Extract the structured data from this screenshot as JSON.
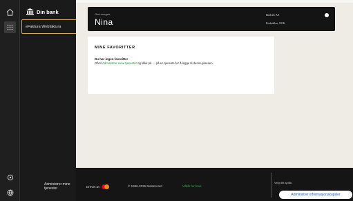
{
  "sidebar": {
    "bank_label": "Din bank",
    "nav_item": "eFaktura Webfaktura",
    "collapse_label": "‹",
    "footer_link": "Administrer mine tjenester"
  },
  "greeting": {
    "salutation": "God morgen,",
    "name": "Nina",
    "company": "Bedrift AS",
    "currency": "Rodedalen, NOK"
  },
  "favorites": {
    "title": "MINE FAVORITTER",
    "empty_heading": "Du har ingen favoritter",
    "text_before": "Gå til ",
    "link_text": "Administrer mine tjenester",
    "text_middle": " og klikk på ",
    "star": "☆",
    "text_after": " på en tjeneste for å legge til denne plassen."
  },
  "footer": {
    "powered_by": "Drevet av",
    "copyright": "© 1996-2026 Mastercard",
    "terms": "Vilkår for bruk",
    "language_label": "Velg ditt språk:",
    "cookie_button": "Administrer informasjonskapsler"
  }
}
